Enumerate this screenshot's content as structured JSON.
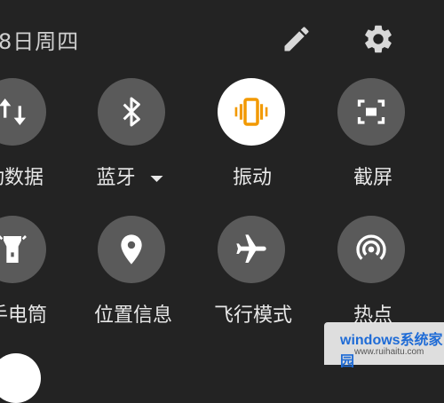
{
  "header": {
    "date_text": "8日周四"
  },
  "tiles": [
    {
      "label": "动数据",
      "icon": "mobile-data-icon",
      "active": false
    },
    {
      "label": "蓝牙",
      "icon": "bluetooth-icon",
      "active": false
    },
    {
      "label": "振动",
      "icon": "vibrate-icon",
      "active": true
    },
    {
      "label": "截屏",
      "icon": "screenshot-icon",
      "active": false
    },
    {
      "label": "手电筒",
      "icon": "flashlight-icon",
      "active": false
    },
    {
      "label": "位置信息",
      "icon": "location-icon",
      "active": false
    },
    {
      "label": "飞行模式",
      "icon": "airplane-icon",
      "active": false
    },
    {
      "label": "热点",
      "icon": "hotspot-icon",
      "active": false
    }
  ],
  "watermark": {
    "title": "windows系统家园",
    "url": "www.ruihaitu.com"
  },
  "colors": {
    "tile_bg": "#5a5a5a",
    "active_accent": "#f29900",
    "background": "#232323"
  }
}
